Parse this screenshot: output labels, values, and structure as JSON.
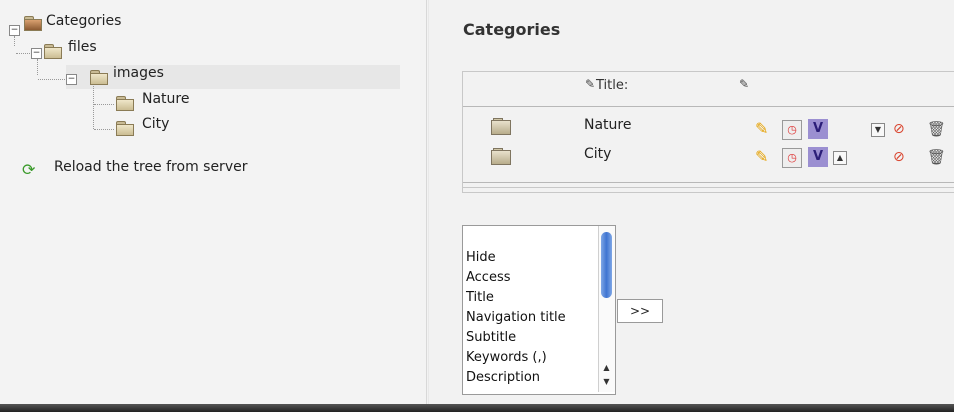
{
  "tree": {
    "root_label": "Categories",
    "files_label": "files",
    "images_label": "images",
    "nature_label": "Nature",
    "city_label": "City",
    "reload_label": "Reload the tree from server"
  },
  "main": {
    "title": "Categories",
    "column_title": "Title:",
    "rows": [
      {
        "title": "Nature"
      },
      {
        "title": "City"
      }
    ],
    "v_label": "V"
  },
  "fieldlist": {
    "options": [
      "Hide",
      "Access",
      "Title",
      "Navigation title",
      "Subtitle",
      "Keywords (,)",
      "Description"
    ],
    "add_button": ">>"
  },
  "colors": {
    "panel_bg": "#f2f2f2",
    "selected_row": "#e7e7e7",
    "v_button": "#9b8fd1",
    "scroll_thumb": "#3e74d1"
  },
  "icons": {
    "tree_root": "categories-folder-icon",
    "folder": "folder-icon",
    "reload": "reload-icon",
    "edit": "pencil-icon",
    "history": "history-icon",
    "hide": "hide-icon",
    "delete": "trash-icon"
  }
}
